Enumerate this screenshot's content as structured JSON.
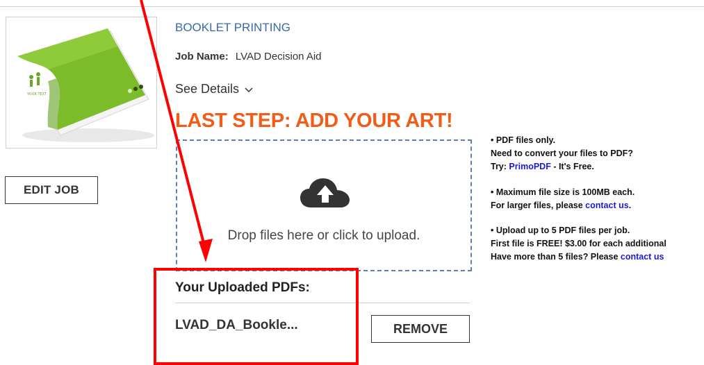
{
  "product": {
    "title": "BOOKLET PRINTING",
    "job_name_label": "Job Name:",
    "job_name_value": "LVAD Decision Aid",
    "see_details_label": "See Details",
    "thumbnail_text": "YOUR TEXT"
  },
  "edit_job_label": "EDIT JOB",
  "upload": {
    "heading": "LAST STEP: ADD YOUR ART!",
    "drop_text": "Drop files here or click to upload.",
    "uploaded_title": "Your Uploaded PDFs:",
    "files": [
      {
        "name": "LVAD_DA_Bookle...",
        "remove_label": "REMOVE"
      }
    ]
  },
  "info": {
    "block1_line1": "• PDF files only.",
    "block1_line2": "Need to convert your files to PDF?",
    "block1_line3_prefix": "Try: ",
    "block1_link": "PrimoPDF",
    "block1_line3_suffix": " - It's Free.",
    "block2_line1": "• Maximum file size is 100MB each.",
    "block2_line2_prefix": "For larger files, please ",
    "block2_link": "contact us",
    "block2_line2_suffix": ".",
    "block3_line1": "• Upload up to 5 PDF files per job.",
    "block3_line2": "First file is FREE! $3.00 for each additional",
    "block3_line3_prefix": "Have more than 5 files? Please ",
    "block3_link": "contact us"
  },
  "colors": {
    "accent_orange": "#f25c19",
    "title_blue": "#3a68a8",
    "link_blue": "#1a1ad6",
    "annotation_red": "#ff0000",
    "dropzone_border": "#5d7fb8"
  },
  "icons": [
    "cloud-upload-icon",
    "chevron-down-icon"
  ]
}
